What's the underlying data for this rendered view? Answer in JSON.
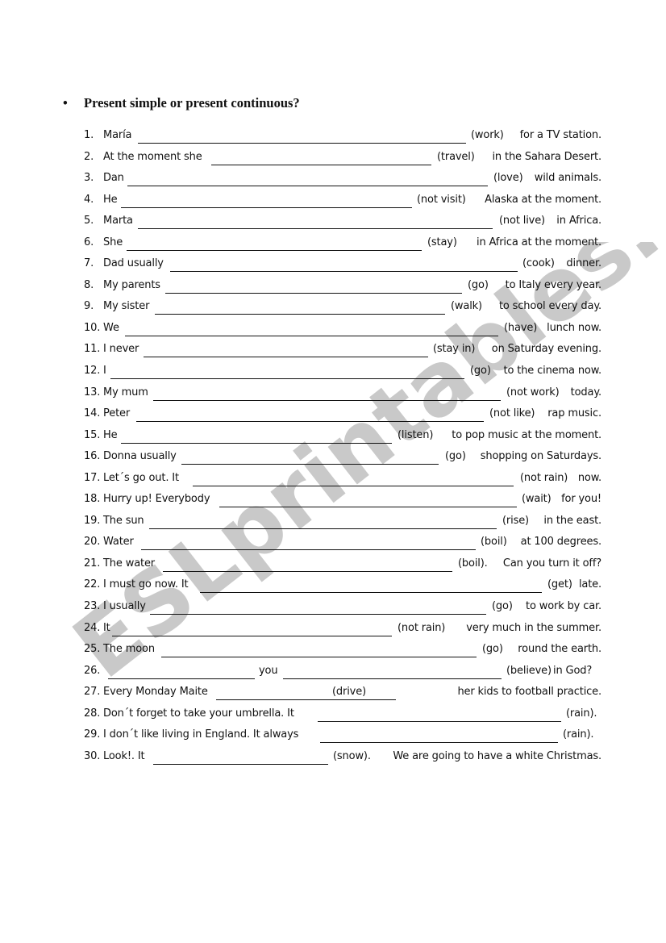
{
  "worksheet": {
    "title": "Present simple or present continuous?",
    "bullet": "•",
    "watermark": "ESLprintables.com",
    "items": [
      {
        "num": "1.",
        "before": "María",
        "verb": "(work)",
        "after": "for a TV station."
      },
      {
        "num": "2.",
        "before": "At the moment she",
        "verb": "(travel)",
        "after": "in the Sahara Desert."
      },
      {
        "num": "3.",
        "before": "Dan",
        "verb": "(love)",
        "after": "wild animals."
      },
      {
        "num": "4.",
        "before": "He",
        "verb": "(not visit)",
        "after": "Alaska at the moment."
      },
      {
        "num": "5.",
        "before": "Marta",
        "verb": "(not live)",
        "after": "in Africa."
      },
      {
        "num": "6.",
        "before": "She",
        "verb": "(stay)",
        "after": "in Africa at the moment."
      },
      {
        "num": "7.",
        "before": "Dad usually",
        "verb": "(cook)",
        "after": "dinner."
      },
      {
        "num": "8.",
        "before": "My parents",
        "verb": "(go)",
        "after": "to Italy every year."
      },
      {
        "num": "9.",
        "before": "My sister",
        "verb": "(walk)",
        "after": "to school every day."
      },
      {
        "num": "10.",
        "before": "We",
        "verb": "(have)",
        "after": "lunch now."
      },
      {
        "num": "11.",
        "before": "I never",
        "verb": "(stay in)",
        "after": "on Saturday evening."
      },
      {
        "num": "12.",
        "before": "I",
        "verb": "(go)",
        "after": "to the cinema now."
      },
      {
        "num": "13.",
        "before": "My mum",
        "verb": "(not work)",
        "after": "today."
      },
      {
        "num": "14.",
        "before": "Peter",
        "verb": "(not like)",
        "after": "rap music."
      },
      {
        "num": "15.",
        "before": "He",
        "verb": "(listen)",
        "after": "to pop music at the moment."
      },
      {
        "num": "16.",
        "before": "Donna usually",
        "verb": "(go)",
        "after": "shopping on Saturdays."
      },
      {
        "num": "17.",
        "before": "Let´s go out. It",
        "verb": "(not rain)",
        "after": "now."
      },
      {
        "num": "18.",
        "before": "Hurry up! Everybody",
        "verb": "(wait)",
        "after": "for you!"
      },
      {
        "num": "19.",
        "before": "The sun",
        "verb": "(rise)",
        "after": "in the east."
      },
      {
        "num": "20.",
        "before": "Water",
        "verb": "(boil)",
        "after": "at 100 degrees."
      },
      {
        "num": "21.",
        "before": "The water",
        "verb": "(boil).",
        "after": "Can you turn it off?"
      },
      {
        "num": "22.",
        "before": "I must go now. It",
        "verb": "(get)",
        "after": "late."
      },
      {
        "num": "23.",
        "before": "I usually",
        "verb": "(go)",
        "after": "to work by car."
      },
      {
        "num": "24.",
        "before": "It",
        "verb": "(not rain)",
        "after": "very much in the summer."
      },
      {
        "num": "25.",
        "before": "The moon",
        "verb": "(go)",
        "after": "round the earth."
      },
      {
        "num": "26.",
        "before": "",
        "middle": "you",
        "verb": "(believe)",
        "after": "in God?"
      },
      {
        "num": "27.",
        "before": "Every Monday Maite",
        "verb": "(drive)",
        "after": "her kids to football practice."
      },
      {
        "num": "28.",
        "before": "Don´t forget to take your umbrella. It",
        "verb": "(rain).",
        "after": ""
      },
      {
        "num": "29.",
        "before": "I don´t like living in England. It always",
        "verb": "(rain).",
        "after": ""
      },
      {
        "num": "30.",
        "before": "Look!. It",
        "verb": "(snow).",
        "after": "We are going to have a white Christmas."
      }
    ]
  }
}
